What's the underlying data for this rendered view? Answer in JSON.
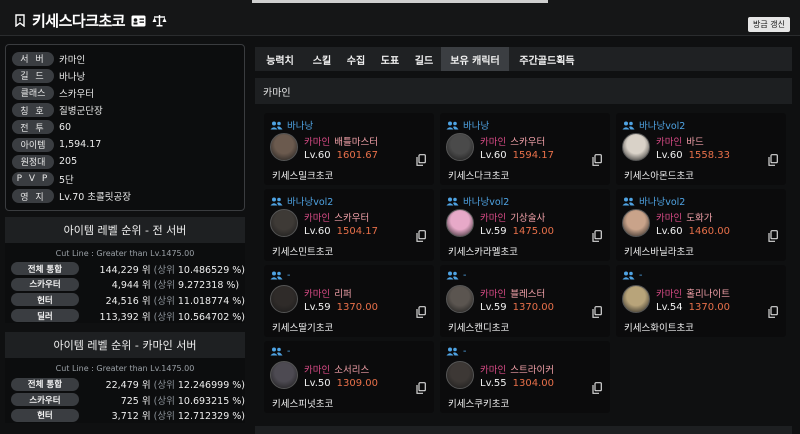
{
  "header": {
    "title": "키세스다크초코",
    "refresh_label": "방금 갱신"
  },
  "profile": [
    {
      "label": "서 버",
      "value": "카마인"
    },
    {
      "label": "길 드",
      "value": "바나낭"
    },
    {
      "label": "클래스",
      "value": "스카우터"
    },
    {
      "label": "칭 호",
      "value": "질병군단장"
    },
    {
      "label": "전 투",
      "value": "60"
    },
    {
      "label": "아이템",
      "value": "1,594.17"
    },
    {
      "label": "원정대",
      "value": "205"
    },
    {
      "label": "P V P",
      "value": "5단"
    },
    {
      "label": "영 지",
      "value": "Lv.70 초콜릿공장"
    }
  ],
  "rank_all": {
    "title": "아이템 레벨 순위 - 전 서버",
    "cutline": "Cut Line : Greater than Lv.1475.00",
    "rows": [
      {
        "label": "전체 통합",
        "rank": "144,229",
        "unit": "위",
        "pre": "(상위",
        "pct": "10.486529 %)"
      },
      {
        "label": "스카우터",
        "rank": "4,944",
        "unit": "위",
        "pre": "(상위",
        "pct": "9.272318 %)"
      },
      {
        "label": "헌터",
        "rank": "24,516",
        "unit": "위",
        "pre": "(상위",
        "pct": "11.018774 %)"
      },
      {
        "label": "딜러",
        "rank": "113,392",
        "unit": "위",
        "pre": "(상위",
        "pct": "10.564702 %)"
      }
    ]
  },
  "rank_server": {
    "title": "아이템 레벨 순위 - 카마인 서버",
    "cutline": "Cut Line : Greater than Lv.1475.00",
    "rows": [
      {
        "label": "전체 통합",
        "rank": "22,479",
        "unit": "위",
        "pre": "(상위",
        "pct": "12.246999 %)"
      },
      {
        "label": "스카우터",
        "rank": "725",
        "unit": "위",
        "pre": "(상위",
        "pct": "10.693215 %)"
      },
      {
        "label": "헌터",
        "rank": "3,712",
        "unit": "위",
        "pre": "(상위",
        "pct": "12.712329 %)"
      }
    ]
  },
  "tabs": [
    "능력치",
    "스킬",
    "수집",
    "도표",
    "길드",
    "보유 캐릭터",
    "주간골드획득"
  ],
  "section_title": "카마인",
  "characters": [
    {
      "guild": "바나낭",
      "server": "카마인",
      "cls": "배틀마스터",
      "lv": "Lv.60",
      "ilvl": "1601.67",
      "name": "키세스밀크초코",
      "avatar": "#6b5a4e"
    },
    {
      "guild": "바나낭",
      "server": "카마인",
      "cls": "스카우터",
      "lv": "Lv.60",
      "ilvl": "1594.17",
      "name": "키세스다크초코",
      "avatar": "#4a4a4a"
    },
    {
      "guild": "바나낭vol2",
      "server": "카마인",
      "cls": "바드",
      "lv": "Lv.60",
      "ilvl": "1558.33",
      "name": "키세스아몬드초코",
      "avatar": "#d9d2c8"
    },
    {
      "guild": "바나낭vol2",
      "server": "카마인",
      "cls": "스카우터",
      "lv": "Lv.60",
      "ilvl": "1504.17",
      "name": "키세스민트초코",
      "avatar": "#3e3a36"
    },
    {
      "guild": "바나낭vol2",
      "server": "카마인",
      "cls": "기상술사",
      "lv": "Lv.59",
      "ilvl": "1475.00",
      "name": "키세스카라멜초코",
      "avatar": "#e7a9c8"
    },
    {
      "guild": "바나낭vol2",
      "server": "카마인",
      "cls": "도화가",
      "lv": "Lv.60",
      "ilvl": "1460.00",
      "name": "키세스바닐라초코",
      "avatar": "#c9a38a"
    },
    {
      "guild": "-",
      "server": "카마인",
      "cls": "리퍼",
      "lv": "Lv.59",
      "ilvl": "1370.00",
      "name": "키세스딸기초코",
      "avatar": "#2f2b29"
    },
    {
      "guild": "-",
      "server": "카마인",
      "cls": "블레스터",
      "lv": "Lv.59",
      "ilvl": "1370.00",
      "name": "키세스캔디초코",
      "avatar": "#5b5550"
    },
    {
      "guild": "-",
      "server": "카마인",
      "cls": "홀리나이트",
      "lv": "Lv.54",
      "ilvl": "1370.00",
      "name": "키세스화이트초코",
      "avatar": "#b8a47a"
    },
    {
      "guild": "-",
      "server": "카마인",
      "cls": "소서리스",
      "lv": "Lv.50",
      "ilvl": "1309.00",
      "name": "키세스피넛초코",
      "avatar": "#4d4a52"
    },
    {
      "guild": "-",
      "server": "카마인",
      "cls": "스트라이커",
      "lv": "Lv.55",
      "ilvl": "1304.00",
      "name": "키세스쿠키초코",
      "avatar": "#3d3835"
    }
  ]
}
